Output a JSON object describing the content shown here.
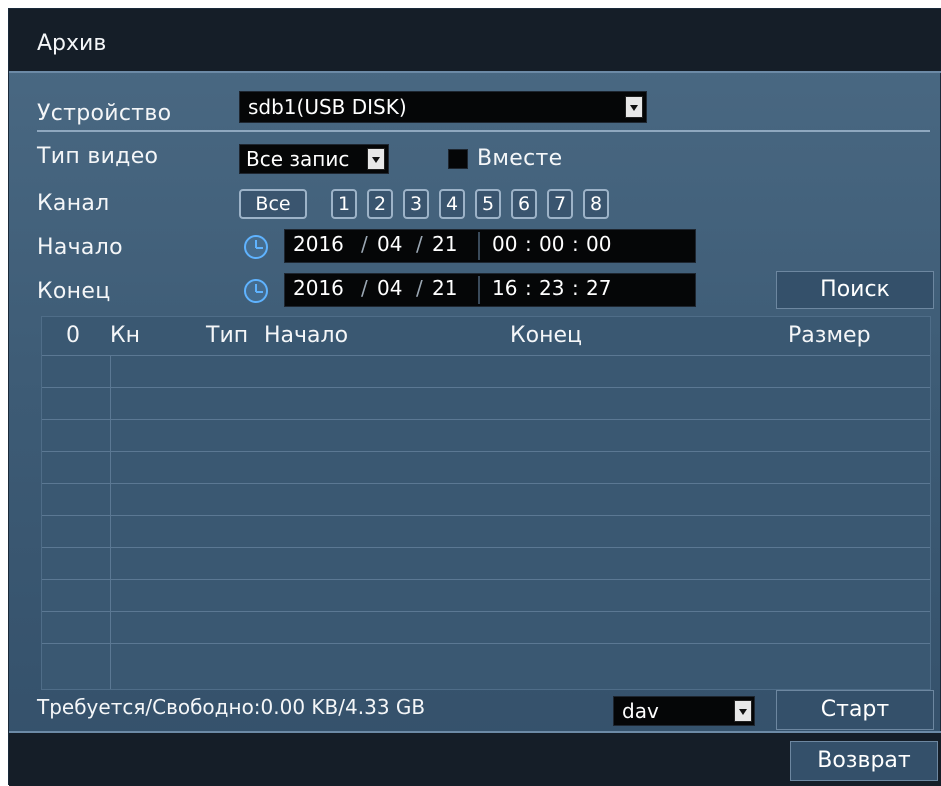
{
  "window": {
    "title": "Архив"
  },
  "device": {
    "label": "Устройство",
    "value": "sdb1(USB DISK)"
  },
  "video_type": {
    "label": "Тип видео",
    "value": "Все запис",
    "together_label": "Вместе"
  },
  "channel": {
    "label": "Канал",
    "buttons": [
      "Все",
      "1",
      "2",
      "3",
      "4",
      "5",
      "6",
      "7",
      "8"
    ]
  },
  "start": {
    "label": "Начало",
    "year": "2016",
    "month": "04",
    "day": "21",
    "hh": "00",
    "mm": "00",
    "ss": "00"
  },
  "end": {
    "label": "Конец",
    "year": "2016",
    "month": "04",
    "day": "21",
    "hh": "16",
    "mm": "23",
    "ss": "27"
  },
  "search_button": "Поиск",
  "table": {
    "headers": [
      "0",
      "Кн",
      "Тип",
      "Начало",
      "Конец",
      "Размер"
    ],
    "rows": []
  },
  "footer": {
    "required_free": "Требуется/Свободно:0.00 KB/4.33 GB",
    "format": "dav",
    "start_button": "Старт",
    "back_button": "Возврат"
  },
  "colors": {
    "accent_icon": "#5fb3ff",
    "panel": "#3d5b75",
    "bar": "#151e28"
  }
}
